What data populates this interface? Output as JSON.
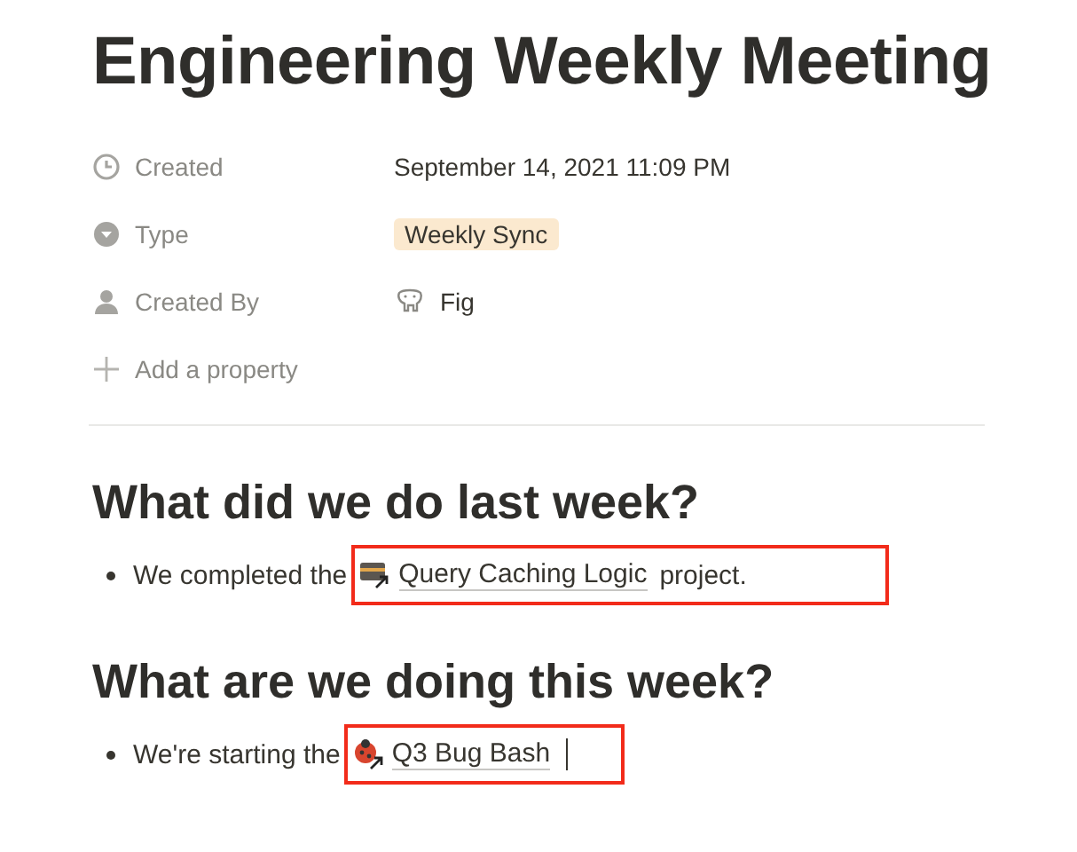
{
  "title": "Engineering Weekly Meeting",
  "properties": [
    {
      "kind": "date",
      "label": "Created",
      "value": "September 14, 2021 11:09 PM"
    },
    {
      "kind": "select",
      "label": "Type",
      "value": "Weekly Sync"
    },
    {
      "kind": "person",
      "label": "Created By",
      "value": "Fig"
    }
  ],
  "add_property": "Add a property",
  "sections": [
    {
      "heading": "What did we do last week?",
      "bullet": {
        "before": "We completed the",
        "kind": "project",
        "link": "Query Caching Logic",
        "after": "project.",
        "highlighted": true
      }
    },
    {
      "heading": "What are we doing this week?",
      "bullet": {
        "before": "We're starting the",
        "kind": "bug",
        "link": "Q3 Bug Bash",
        "highlighted": true,
        "cursor": true
      }
    }
  ]
}
